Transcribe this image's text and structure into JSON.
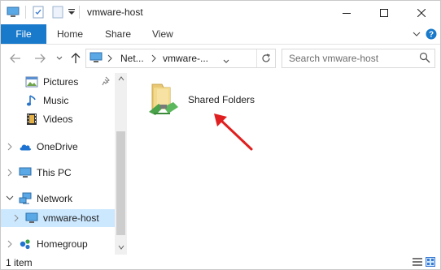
{
  "window": {
    "title": "vmware-host",
    "accent": "#1979ca"
  },
  "ribbon": {
    "tabs": [
      {
        "label": "File"
      },
      {
        "label": "Home"
      },
      {
        "label": "Share"
      },
      {
        "label": "View"
      }
    ]
  },
  "address": {
    "parts": [
      "Net...",
      "vmware-..."
    ],
    "search_placeholder": "Search vmware-host"
  },
  "nav": {
    "items": [
      {
        "label": "Pictures",
        "icon": "pictures-icon",
        "pinned": true
      },
      {
        "label": "Music",
        "icon": "music-icon"
      },
      {
        "label": "Videos",
        "icon": "videos-icon"
      },
      {
        "label": "OneDrive",
        "icon": "onedrive-icon"
      },
      {
        "label": "This PC",
        "icon": "this-pc-icon"
      },
      {
        "label": "Network",
        "icon": "network-icon",
        "expanded": true
      },
      {
        "label": "vmware-host",
        "icon": "computer-icon",
        "selected": true
      },
      {
        "label": "Homegroup",
        "icon": "homegroup-icon"
      }
    ]
  },
  "content": {
    "items": [
      {
        "name": "Shared Folders",
        "icon": "shared-folder-icon"
      }
    ],
    "annotation": "red-arrow-icon"
  },
  "status": {
    "text": "1 item"
  }
}
